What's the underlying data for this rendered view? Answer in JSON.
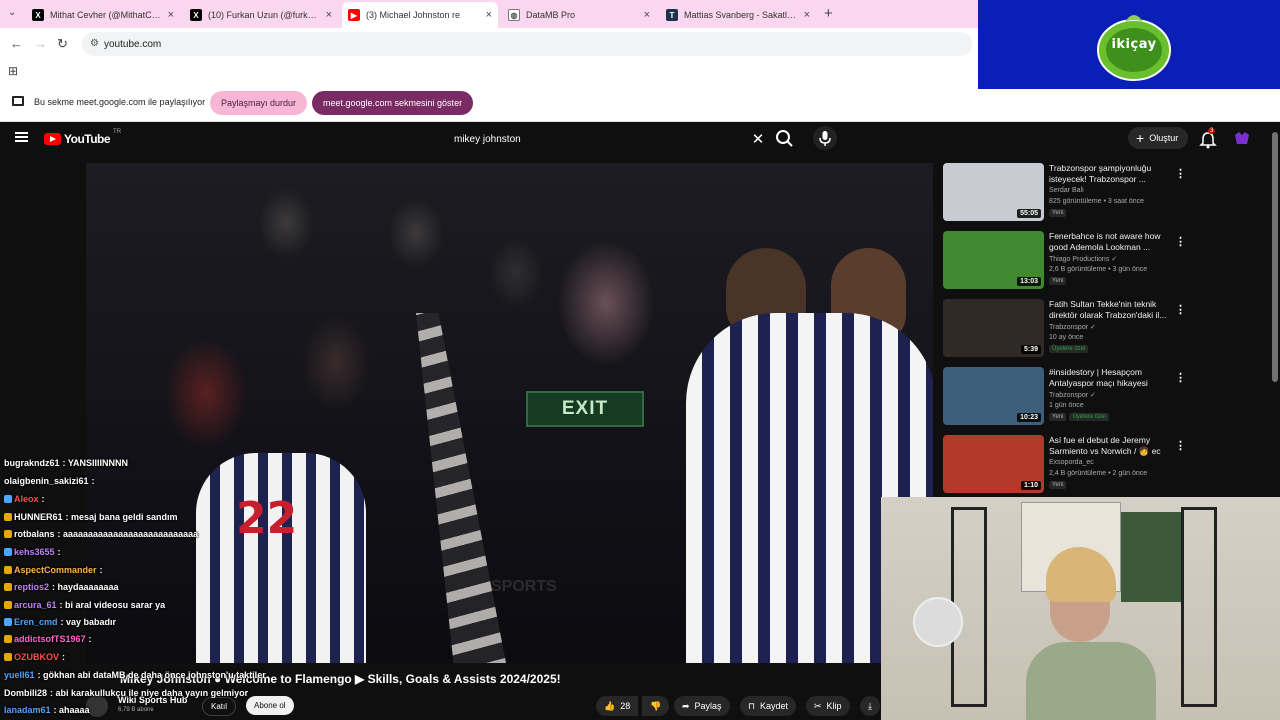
{
  "browser": {
    "tabs": [
      {
        "title": "Mithat Cevher (@MithatCevher",
        "favicon": "x-icon",
        "color": "#000000"
      },
      {
        "title": "(10) Furkan Uzun (@furkan_uzu",
        "favicon": "x-icon",
        "color": "#000000"
      },
      {
        "title": "(3) Michael Johnston re",
        "favicon": "youtube-icon",
        "color": "#ff0000"
      },
      {
        "title": "DataMB Pro",
        "favicon": "globe-icon",
        "color": "#5f6368"
      },
      {
        "title": "Mattias Svanberg - Sakatlık geç",
        "favicon": "tm-icon",
        "color": "#1a3150"
      }
    ],
    "url": "youtube.com",
    "share_bar": {
      "message": "Bu sekme meet.google.com ile paylaşılıyor",
      "stop_label": "Paylaşmayı durdur",
      "goto_label": "meet.google.com sekmesini göster"
    }
  },
  "overlay_logo": {
    "text": "ikiçay",
    "bg_color": "#0a1fb6",
    "accent": "#6abf2e"
  },
  "youtube": {
    "logo_word": "YouTube",
    "logo_suffix": "TR",
    "search_query": "mikey johnston",
    "create_label": "Oluştur",
    "notification_count": "3",
    "video": {
      "title": "Mikey Johnston ● Welcome to Flamengo ▶ Skills, Goals & Assists 2024/2025!",
      "channel": "Wiki Sports Hub",
      "subscribers": "6,79 B abone",
      "join_label": "Katıl",
      "subscribe_label": "Abone ol",
      "likes": "28",
      "share_label": "Paylaş",
      "save_label": "Kaydet",
      "clip_label": "Klip",
      "exit_sign": "EXIT",
      "jersey_number": "22",
      "watermark": "SPORTS"
    },
    "recommendations": [
      {
        "title": "Trabzonspor şampiyonluğu isteyecek! Trabzonspor ...",
        "channel": "Serdar Bali",
        "meta": "825 görüntüleme • 3 saat önce",
        "duration": "55:05",
        "tags": [
          "Yeni"
        ],
        "thumb_color": "#c8ccd2"
      },
      {
        "title": "Fenerbahce is not aware how good Ademola Lookman ...",
        "channel": "Thiago Productions ✓",
        "meta": "2,6 B görüntüleme • 3 gün önce",
        "duration": "13:03",
        "tags": [
          "Yeni"
        ],
        "thumb_color": "#3f8a2e"
      },
      {
        "title": "Fatih Sultan Tekke'nin teknik direktör olarak Trabzon'daki il...",
        "channel": "Trabzonspor ✓",
        "meta": "10 ay önce",
        "duration": "5:39",
        "tags": [
          "Üyelere özel"
        ],
        "thumb_color": "#2f2a26"
      },
      {
        "title": "#insidestory | Hesapçom Antalyaspor maçı hikayesi",
        "channel": "Trabzonspor ✓",
        "meta": "1 gün önce",
        "duration": "10:23",
        "tags": [
          "Yeni",
          "Üyelere özel"
        ],
        "thumb_color": "#3d5e7a"
      },
      {
        "title": "Así fue el debut de Jeremy Sarmiento vs Norwich / 🧑 ec",
        "channel": "Exsoporda_ec",
        "meta": "2,4 B görüntüleme • 2 gün önce",
        "duration": "1:10",
        "tags": [
          "Yeni"
        ],
        "thumb_color": "#b33a2a"
      }
    ]
  },
  "chat": [
    {
      "user": "bugrakndz61",
      "msg": ": YANSIIIINNNN",
      "color": "#ffffff",
      "badge": "none"
    },
    {
      "user": "olaigbenin_sakizi61",
      "msg": ":",
      "color": "#ffffff",
      "badge": "none"
    },
    {
      "user": "Aleox",
      "msg": ":",
      "color": "#ff4d4d",
      "badge": "blue"
    },
    {
      "user": "HUNNER61",
      "msg": ": mesaj bana geldi sandım",
      "color": "#ffffff",
      "badge": "gold"
    },
    {
      "user": "rotbalans",
      "msg": ": aaaaaaaaaaaaaaaaaaaaaaaaaaa",
      "color": "#ffffff",
      "badge": "gold"
    },
    {
      "user": "kehs3655",
      "msg": ":",
      "color": "#c080ff",
      "badge": "blue"
    },
    {
      "user": "AspectCommander",
      "msg": ":",
      "color": "#ffb347",
      "badge": "gold"
    },
    {
      "user": "reptios2",
      "msg": ": haydaaaaaaaa",
      "color": "#c080ff",
      "badge": "gold"
    },
    {
      "user": "arcura_61",
      "msg": ": bi aral videosu sarar ya",
      "color": "#c080ff",
      "badge": "gold"
    },
    {
      "user": "Eren_cmd",
      "msg": ": vay babadır",
      "color": "#4da6ff",
      "badge": "blue"
    },
    {
      "user": "addictsofTS1967",
      "msg": ":",
      "color": "#ff66cc",
      "badge": "gold"
    },
    {
      "user": "OZUBKOV",
      "msg": ":",
      "color": "#ff4d4d",
      "badge": "gold"
    },
    {
      "user": "yuell61",
      "msg": ": gökhan abi dataMB de daha önce johnston'u taktiler",
      "color": "#4da6ff",
      "badge": "none"
    },
    {
      "user": "Dombili28",
      "msg": ": abi karakullukçu ile niye daha yayın gelmiyor",
      "color": "#ffffff",
      "badge": "none"
    },
    {
      "user": "lanadam61",
      "msg": ": ahaaaa",
      "color": "#4da6ff",
      "badge": "none"
    }
  ]
}
